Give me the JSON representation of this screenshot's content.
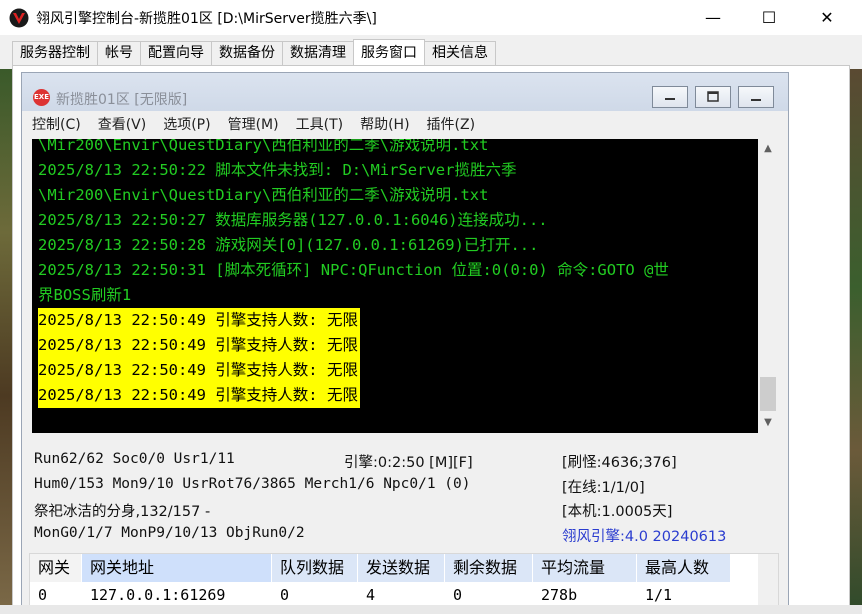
{
  "window": {
    "title": "翎风引擎控制台-新揽胜01区 [D:\\MirServer揽胜六季\\]",
    "min_glyph": "—",
    "max_glyph": "☐",
    "close_glyph": "✕"
  },
  "tabs": [
    {
      "label": "服务器控制"
    },
    {
      "label": "帐号"
    },
    {
      "label": "配置向导"
    },
    {
      "label": "数据备份"
    },
    {
      "label": "数据清理"
    },
    {
      "label": "服务窗口",
      "active": true
    },
    {
      "label": "相关信息"
    }
  ],
  "child": {
    "icon_text": "EXE",
    "title": "新揽胜01区 [无限版]",
    "menu": [
      "控制(C)",
      "查看(V)",
      "选项(P)",
      "管理(M)",
      "工具(T)",
      "帮助(H)",
      "插件(Z)"
    ]
  },
  "log": [
    {
      "text": "\\Mir200\\Envir\\QuestDiary\\西伯利亚的二季\\游戏说明.txt",
      "hl": false
    },
    {
      "text": "2025/8/13 22:50:22 脚本文件未找到: D:\\MirServer揽胜六季",
      "hl": false
    },
    {
      "text": "\\Mir200\\Envir\\QuestDiary\\西伯利亚的二季\\游戏说明.txt",
      "hl": false
    },
    {
      "text": "2025/8/13 22:50:27 数据库服务器(127.0.0.1:6046)连接成功...",
      "hl": false
    },
    {
      "text": "2025/8/13 22:50:28 游戏网关[0](127.0.0.1:61269)已打开...",
      "hl": false
    },
    {
      "text": "2025/8/13 22:50:31 [脚本死循环] NPC:QFunction 位置:0(0:0) 命令:GOTO @世",
      "hl": false
    },
    {
      "text": "界BOSS刷新1",
      "hl": false
    },
    {
      "text": "2025/8/13 22:50:49 引擎支持人数: 无限",
      "hl": true
    },
    {
      "text": "2025/8/13 22:50:49 引擎支持人数: 无限",
      "hl": true
    },
    {
      "text": "2025/8/13 22:50:49 引擎支持人数: 无限",
      "hl": true
    },
    {
      "text": "2025/8/13 22:50:49 引擎支持人数: 无限",
      "hl": true
    }
  ],
  "status": {
    "run": "Run62/62 Soc0/0 Usr1/11",
    "engine_time": "引擎:0:2:50 [M][F]",
    "refresh_monster": "[刷怪:4636;376]",
    "hum": "Hum0/153 Mon9/10 UsrRot76/3865 Merch1/6 Npc0/1 (0)",
    "online": "[在线:1/1/0]",
    "event": "祭祀冰洁的分身,132/157 -",
    "local": "[本机:1.0005天]",
    "mon": "MonG0/1/7 MonP9/10/13 ObjRun0/2",
    "version": "翎风引擎:4.0 20240613"
  },
  "grid": {
    "headers": [
      "网关",
      "网关地址",
      "队列数据",
      "发送数据",
      "剩余数据",
      "平均流量",
      "最高人数"
    ],
    "rows": [
      [
        "0",
        "127.0.0.1:61269",
        "0",
        "4",
        "0",
        "278b",
        "1/1"
      ]
    ]
  }
}
